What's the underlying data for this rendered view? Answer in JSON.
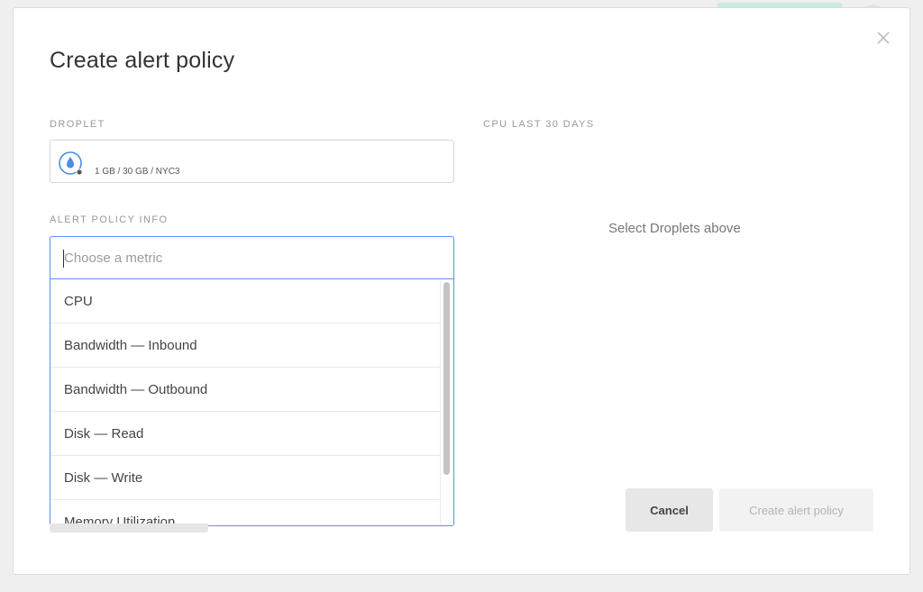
{
  "modal": {
    "title": "Create alert policy",
    "close_icon": "close-icon"
  },
  "droplet": {
    "label": "DROPLET",
    "icon": "droplet-icon",
    "specs": "1 GB / 30 GB / NYC3"
  },
  "cpu_panel": {
    "label": "CPU LAST 30 DAYS",
    "empty_message": "Select Droplets above"
  },
  "policy": {
    "label": "ALERT POLICY INFO",
    "metric_placeholder": "Choose a metric",
    "metric_value": "",
    "options": [
      "CPU",
      "Bandwidth — Inbound",
      "Bandwidth — Outbound",
      "Disk — Read",
      "Disk — Write",
      "Memory Utilization"
    ]
  },
  "footer": {
    "cancel_label": "Cancel",
    "create_label": "Create alert policy"
  },
  "colors": {
    "accent": "#5b8ff9",
    "droplet_blue": "#4a90e2",
    "background": "#efefef"
  }
}
